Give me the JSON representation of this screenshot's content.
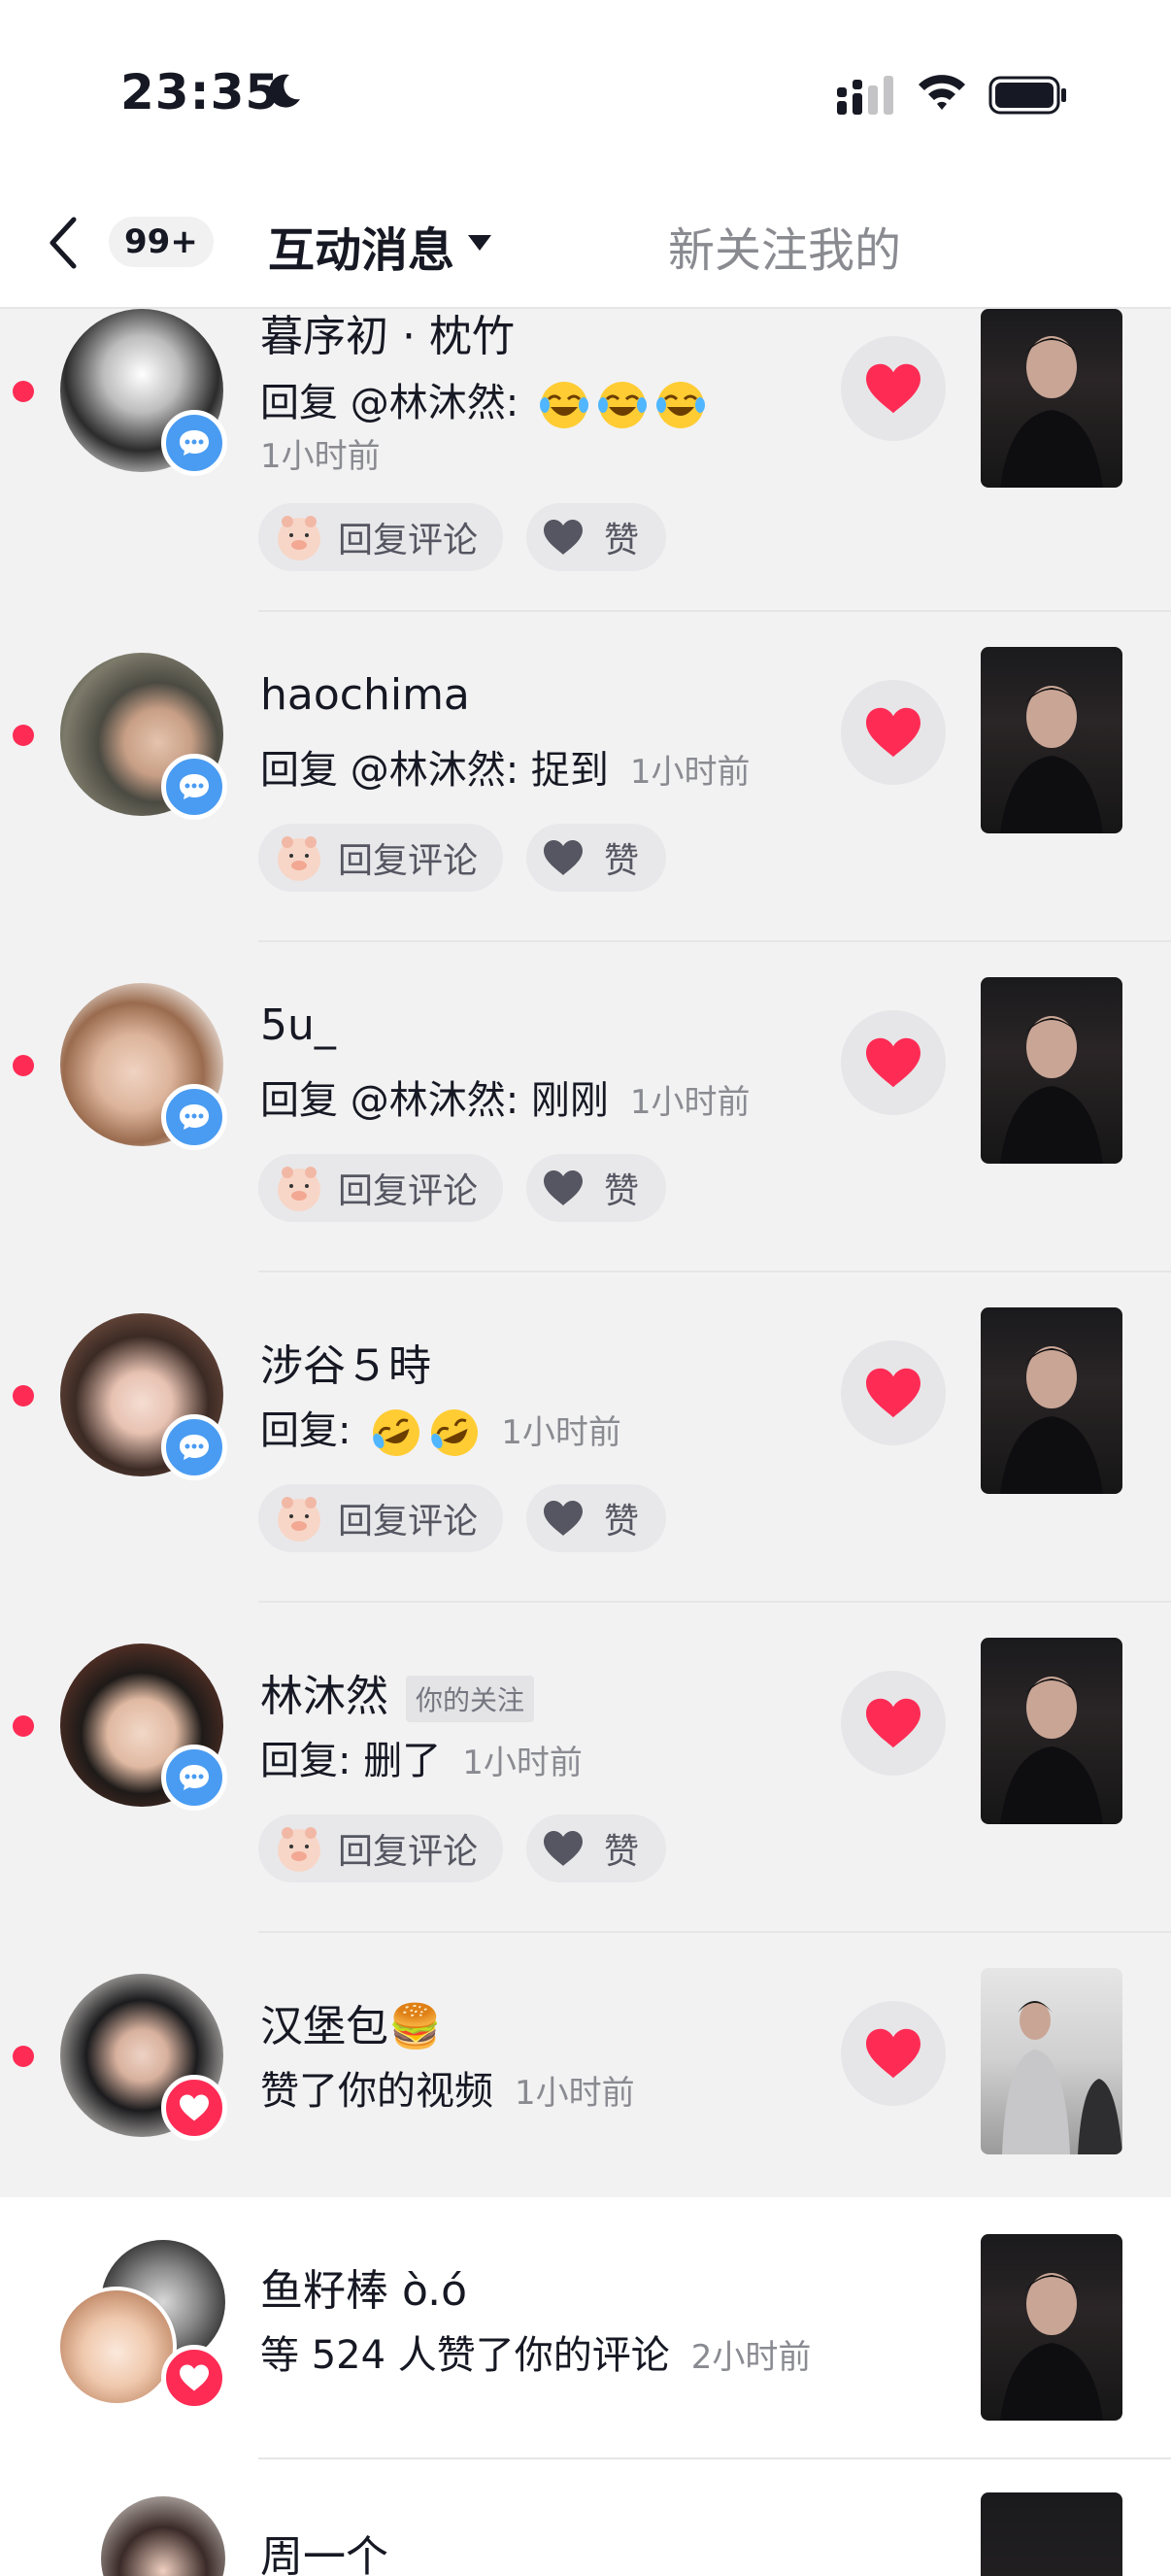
{
  "status_bar": {
    "time": "23:35"
  },
  "nav": {
    "unread_badge": "99+",
    "active_tab": "互动消息",
    "other_tab": "新关注我的"
  },
  "actions": {
    "reply": "回复评论",
    "like": "赞"
  },
  "items": [
    {
      "name": "暮序初 · 枕竹",
      "message": "回复 @林沐然: ",
      "emoji": [
        "😂",
        "😂",
        "😂"
      ],
      "time": "1小时前"
    },
    {
      "name": "haochima",
      "message": "回复 @林沐然: 捉到",
      "time": "1小时前"
    },
    {
      "name": "5u_",
      "message": "回复 @林沐然: 刚刚",
      "time": "1小时前"
    },
    {
      "name": "涉谷５時",
      "message": "回复: ",
      "emoji": [
        "🤣",
        "🤣"
      ],
      "time": "1小时前"
    },
    {
      "name": "林沐然",
      "tag": "你的关注",
      "message": "回复: 删了",
      "time": "1小时前"
    },
    {
      "name": "汉堡包🍔",
      "message": "赞了你的视频",
      "time": "1小时前"
    },
    {
      "name": "鱼籽棒 ò.ó",
      "message": "等 524 人赞了你的评论",
      "time": "2小时前"
    },
    {
      "name": "周一个"
    }
  ],
  "colors": {
    "accent_red": "#fe2c55",
    "comment_blue": "#4a9cf2",
    "unread_bg": "#f2f2f3"
  }
}
